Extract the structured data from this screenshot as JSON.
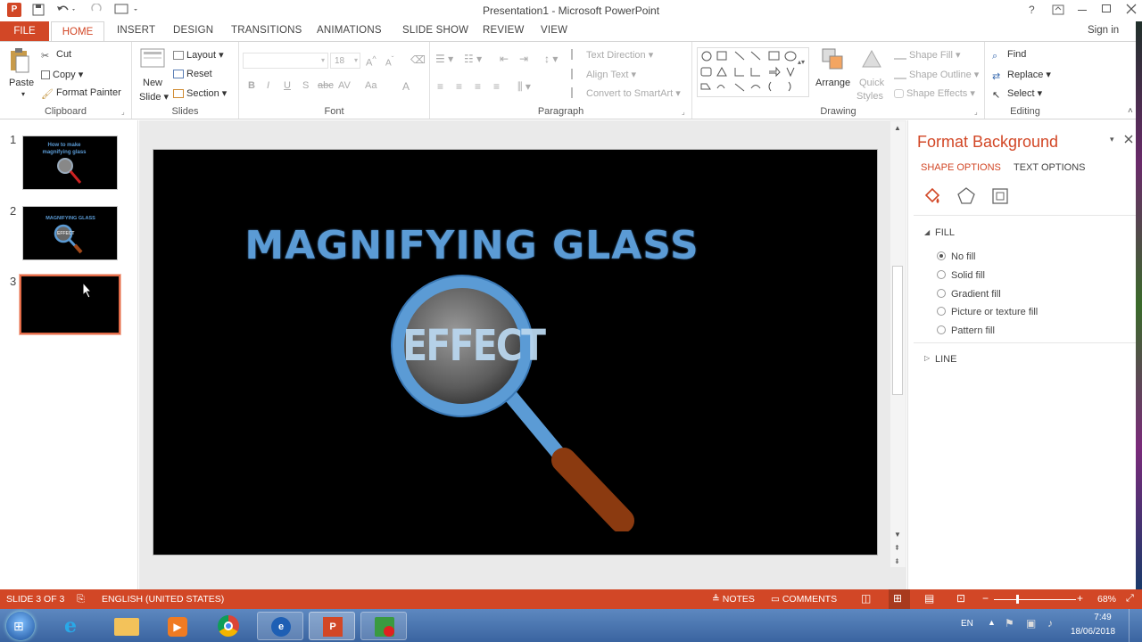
{
  "window": {
    "title": "Presentation1 - Microsoft PowerPoint",
    "help": "?",
    "sign_in": "Sign in"
  },
  "tabs": [
    "FILE",
    "HOME",
    "INSERT",
    "DESIGN",
    "TRANSITIONS",
    "ANIMATIONS",
    "SLIDE SHOW",
    "REVIEW",
    "VIEW"
  ],
  "ribbon": {
    "clipboard": {
      "label": "Clipboard",
      "paste": "Paste",
      "cut": "Cut",
      "copy": "Copy",
      "format_painter": "Format Painter"
    },
    "slides": {
      "label": "Slides",
      "new_slide_1": "New",
      "new_slide_2": "Slide",
      "layout": "Layout",
      "reset": "Reset",
      "section": "Section"
    },
    "font": {
      "label": "Font",
      "size": "18",
      "bold": "B",
      "italic": "I",
      "underline": "U",
      "shadow": "S",
      "strike": "abc",
      "spacing": "AV",
      "case": "Aa",
      "color": "A"
    },
    "paragraph": {
      "label": "Paragraph",
      "text_direction": "Text Direction",
      "align_text": "Align Text",
      "convert": "Convert to SmartArt"
    },
    "drawing": {
      "label": "Drawing",
      "arrange": "Arrange",
      "quick_1": "Quick",
      "quick_2": "Styles",
      "shape_fill": "Shape Fill",
      "shape_outline": "Shape Outline",
      "shape_effects": "Shape Effects"
    },
    "editing": {
      "label": "Editing",
      "find": "Find",
      "replace": "Replace",
      "select": "Select"
    }
  },
  "thumbnails": [
    {
      "num": "1",
      "title_1": "How to make",
      "title_2": "magnifying glass"
    },
    {
      "num": "2",
      "title": "MAGNIFYING GLASS",
      "lens": "EFFECT"
    },
    {
      "num": "3"
    }
  ],
  "slide": {
    "title": "MAGNIFYING GLASS",
    "lens_text": "EFFECT"
  },
  "format_pane": {
    "title": "Format Background",
    "shape_options": "SHAPE OPTIONS",
    "text_options": "TEXT OPTIONS",
    "fill": "FILL",
    "options": [
      "No fill",
      "Solid fill",
      "Gradient fill",
      "Picture or texture fill",
      "Pattern fill"
    ],
    "line": "LINE"
  },
  "status": {
    "slide": "SLIDE 3 OF 3",
    "language": "ENGLISH (UNITED STATES)",
    "notes": "NOTES",
    "comments": "COMMENTS",
    "zoom": "68%"
  },
  "taskbar": {
    "lang": "EN",
    "time": "7:49",
    "date": "18/06/2018"
  },
  "colors": {
    "accent": "#d24726",
    "title_blue": "#5b9bd5",
    "handle_brown": "#8b3a10"
  }
}
